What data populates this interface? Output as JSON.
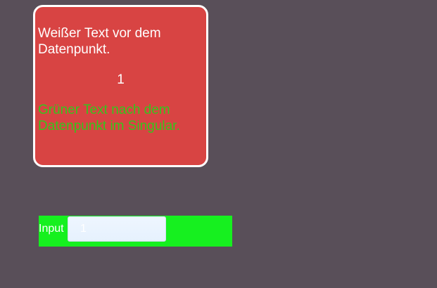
{
  "card": {
    "text_before": "Weißer Text vor dem Datenpunkt.",
    "value": "1",
    "text_after": "Grüner Text nach dem Datenpunkt im Singular."
  },
  "input": {
    "label": "Input",
    "value": "1"
  },
  "colors": {
    "background": "#594f59",
    "card_background": "#d84443",
    "card_border": "#ffffff",
    "text_before": "#ffffff",
    "text_after": "#35c51c",
    "input_bar": "#16f01f"
  }
}
